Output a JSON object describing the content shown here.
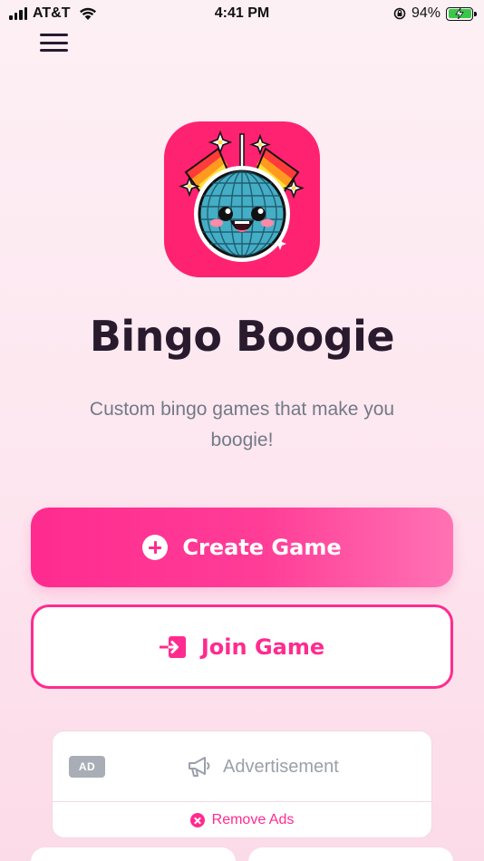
{
  "status_bar": {
    "carrier": "AT&T",
    "time": "4:41 PM",
    "battery_percent": "94%",
    "battery_level": 0.94,
    "icons": [
      "signal-icon",
      "wifi-icon",
      "rotation-lock-icon",
      "battery-charging-icon"
    ]
  },
  "header": {
    "menu_icon": "hamburger-menu-icon"
  },
  "app": {
    "logo_icon": "disco-ball-logo-icon",
    "title": "Bingo Boogie",
    "tagline": "Custom bingo games that make you boogie!"
  },
  "actions": {
    "create_label": "Create Game",
    "create_icon": "plus-circle-icon",
    "join_label": "Join Game",
    "join_icon": "sign-in-icon"
  },
  "ad": {
    "badge": "AD",
    "label": "Advertisement",
    "icon": "megaphone-icon",
    "remove_label": "Remove Ads",
    "remove_icon": "close-circle-icon"
  },
  "colors": {
    "accent": "#ff2b8f",
    "logo_bg": "#ff2270",
    "title_text": "#2a1a2e",
    "subtitle_text": "#727a86"
  }
}
